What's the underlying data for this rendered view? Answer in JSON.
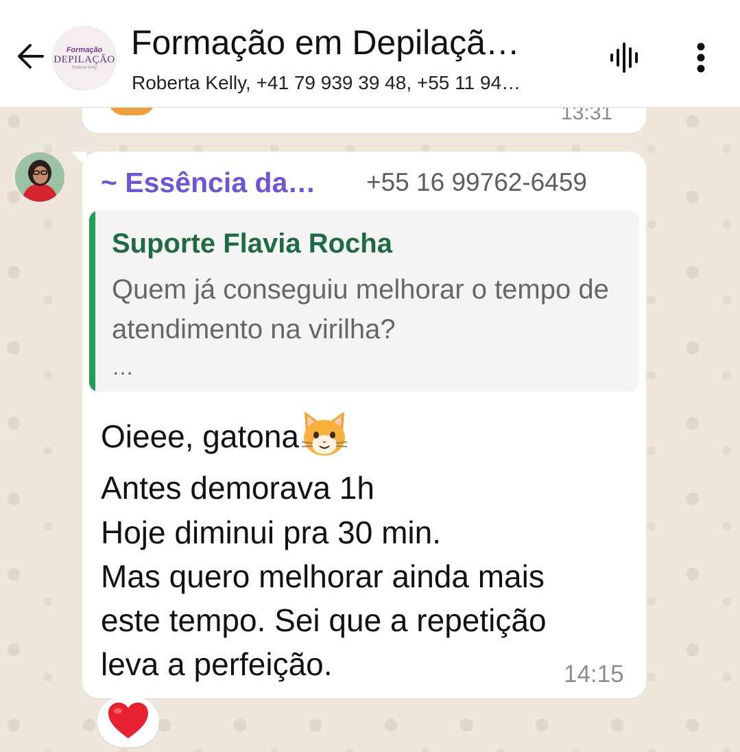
{
  "header": {
    "title": "Formação em Depilaçã…",
    "subtitle": "Roberta Kelly, +41 79 939 39 48, +55 11 94…",
    "avatar_logo": {
      "line1": "Formação",
      "line2": "DEPILAÇÃO",
      "line3": "Roberta Kelly"
    },
    "icons": {
      "back": "arrow-left-icon",
      "voice": "voice-waveform-icon",
      "menu": "more-vertical-icon"
    }
  },
  "previous_message": {
    "time": "13:31"
  },
  "message": {
    "sender_name": "~ Essência da…",
    "sender_phone": "+55 16 99762-6459",
    "quoted": {
      "author": "Suporte Flavia Rocha",
      "text": "Quem já conseguiu melhorar o tempo de atendimento na virilha?",
      "more": "…"
    },
    "greeting": "Oieee, gatona",
    "greeting_emoji": "cat-face-emoji",
    "lines": [
      "Antes demorava 1h",
      "Hoje diminui pra 30 min.",
      "Mas quero melhorar ainda mais",
      "este tempo. Sei que a repetição",
      "leva a perfeição."
    ],
    "time": "14:15",
    "reaction": "❤️"
  },
  "colors": {
    "sender_name": "#6d55d8",
    "quote_bar": "#1f9e55",
    "quote_author": "#1e6b43",
    "chat_background": "#efe7dc"
  }
}
